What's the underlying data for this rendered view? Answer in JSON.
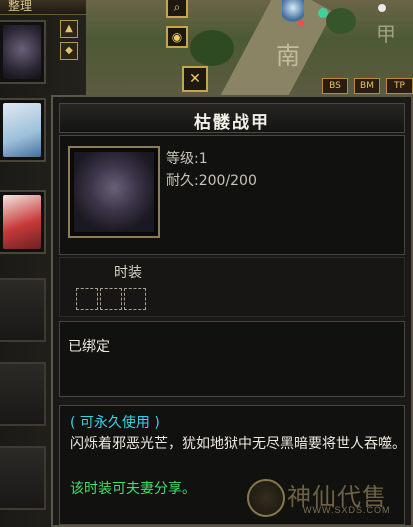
{
  "left_column": {
    "tab_label": "整理",
    "slots": [
      {
        "name": "armor-slot",
        "filled": true
      },
      {
        "name": "robe-slot",
        "filled": true
      },
      {
        "name": "fashion-slot",
        "filled": true
      },
      {
        "name": "empty-slot-1",
        "filled": false
      },
      {
        "name": "empty-slot-2",
        "filled": false
      },
      {
        "name": "empty-slot-3",
        "filled": false
      },
      {
        "name": "empty-slot-4",
        "filled": false
      }
    ]
  },
  "map": {
    "direction_label": "南",
    "corner_label": "甲",
    "buttons": [
      "BS",
      "BM",
      "TP"
    ]
  },
  "tooltip": {
    "item_name": "枯髅战甲",
    "level_label": "等级:1",
    "durability_label": "耐久:200/200",
    "type_label": "时装",
    "gem_slots": 3,
    "bind_status": "已绑定",
    "usage_header": "( 可永久使用 )",
    "description": "闪烁着邪恶光芒，犹如地狱中无尽黑暗要将世人吞噬。",
    "share_note": "该时装可夫妻分享。"
  },
  "watermark": {
    "brand": "神仙代售",
    "url": "WWW.SXDS.COM"
  },
  "colors": {
    "cyan": "#35d3e6",
    "green": "#3fe06a",
    "frame_gold": "#8c7d54"
  }
}
